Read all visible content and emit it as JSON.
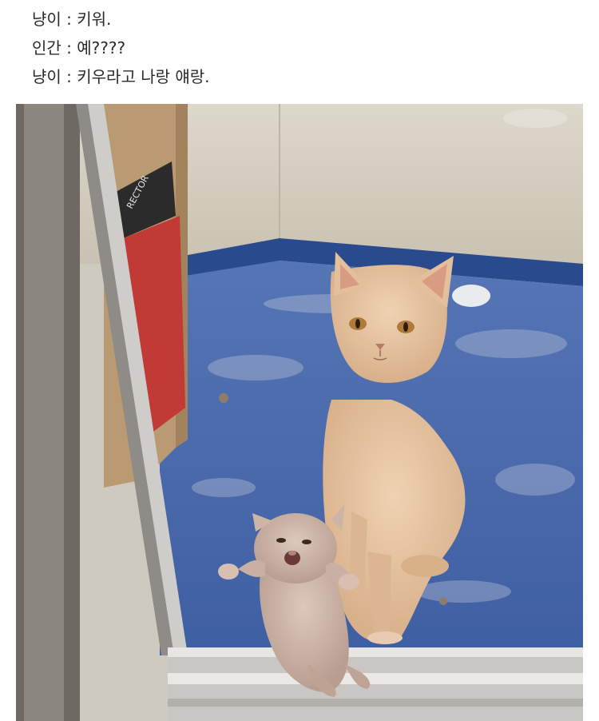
{
  "caption": {
    "lines": [
      "냥이 : 키워.",
      "인간 : 예????",
      "냥이 : 키우라고 나랑 얘랑."
    ]
  },
  "photo": {
    "box_label": "RECTOR",
    "colors": {
      "wall": "#d6d0c2",
      "baseboard": "#2a4a8e",
      "floor": "#4a6cb0",
      "cat_fur": "#e3c2a0",
      "kitten_fur": "#cbb4a6",
      "box_red": "#c23a35"
    }
  }
}
